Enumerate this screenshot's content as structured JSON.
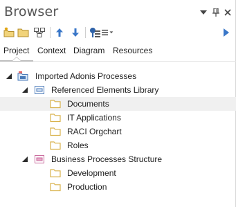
{
  "window": {
    "title": "Browser",
    "controls": [
      "dropdown-icon",
      "pin-icon",
      "close-icon"
    ]
  },
  "toolbar": {
    "buttons": [
      "new-package-icon",
      "new-folder-icon",
      "new-diagram-icon",
      "move-up-icon",
      "move-down-icon",
      "properties-icon",
      "menu-icon",
      "expand-right-icon"
    ]
  },
  "tabs": {
    "items": [
      {
        "label": "Project",
        "active": true
      },
      {
        "label": "Context",
        "active": false
      },
      {
        "label": "Diagram",
        "active": false
      },
      {
        "label": "Resources",
        "active": false
      }
    ]
  },
  "tree": {
    "nodes": [
      {
        "label": "Imported Adonis Processes",
        "level": 0,
        "icon": "model-root-icon",
        "expanded": true,
        "selected": false
      },
      {
        "label": "Referenced Elements Library",
        "level": 1,
        "icon": "view-package-icon",
        "expanded": true,
        "selected": false
      },
      {
        "label": "Documents",
        "level": 2,
        "icon": "folder-icon",
        "expanded": false,
        "selected": true
      },
      {
        "label": "IT Applications",
        "level": 2,
        "icon": "folder-icon",
        "expanded": false,
        "selected": false
      },
      {
        "label": "RACI Orgchart",
        "level": 2,
        "icon": "folder-icon",
        "expanded": false,
        "selected": false
      },
      {
        "label": "Roles",
        "level": 2,
        "icon": "folder-icon",
        "expanded": false,
        "selected": false
      },
      {
        "label": "Business Processes Structure",
        "level": 1,
        "icon": "process-view-icon",
        "expanded": true,
        "selected": false
      },
      {
        "label": "Development",
        "level": 2,
        "icon": "folder-icon",
        "expanded": false,
        "selected": false
      },
      {
        "label": "Production",
        "level": 2,
        "icon": "folder-icon",
        "expanded": false,
        "selected": false
      }
    ]
  },
  "colors": {
    "folder": "#d9b24c",
    "accent_blue": "#3a77c8",
    "selected_row": "#f0f0f0",
    "view_pink": "#e9a8c8"
  }
}
